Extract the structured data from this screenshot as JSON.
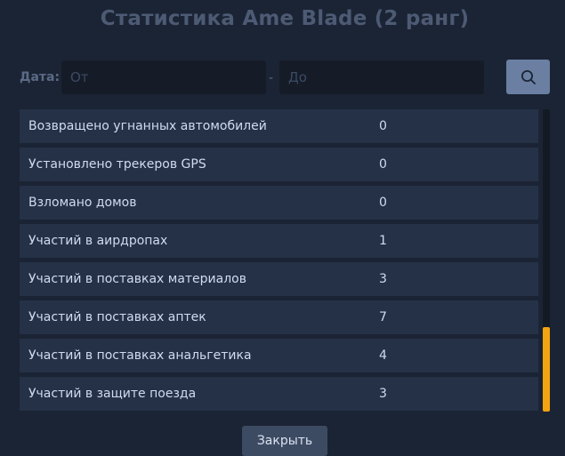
{
  "title": "Статистика Ame Blade (2 ранг)",
  "filter": {
    "date_label": "Дата:",
    "from_placeholder": "От",
    "to_placeholder": "До",
    "separator": "-",
    "search_icon": "search-icon"
  },
  "stats": [
    {
      "label": "Возвращено угнанных автомобилей",
      "value": "0"
    },
    {
      "label": "Установлено трекеров GPS",
      "value": "0"
    },
    {
      "label": "Взломано домов",
      "value": "0"
    },
    {
      "label": "Участий в аирдропах",
      "value": "1"
    },
    {
      "label": "Участий в поставках материалов",
      "value": "3"
    },
    {
      "label": "Участий в поставках аптек",
      "value": "7"
    },
    {
      "label": "Участий в поставках анальгетика",
      "value": "4"
    },
    {
      "label": "Участий в защите поезда",
      "value": "3"
    }
  ],
  "scrollbar": {
    "position_fraction": 0.72,
    "thumb_fraction": 0.28,
    "thumb_color": "#f3a410"
  },
  "close_label": "Закрыть",
  "colors": {
    "background": "#1b2434",
    "row": "#253147",
    "accent": "#f3a410",
    "search_button": "#6a7fa2"
  }
}
